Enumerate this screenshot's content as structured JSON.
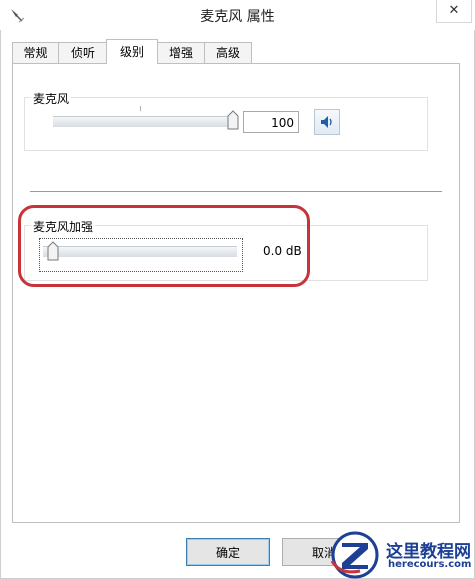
{
  "window": {
    "title": "麦克风 属性",
    "close_glyph": "✕"
  },
  "tabs": [
    {
      "label": "常规",
      "active": false
    },
    {
      "label": "侦听",
      "active": false
    },
    {
      "label": "级别",
      "active": true
    },
    {
      "label": "增强",
      "active": false
    },
    {
      "label": "高级",
      "active": false
    }
  ],
  "microphone": {
    "label": "麦克风",
    "level_value": "100",
    "level_fraction": 1.0,
    "speaker_icon": "speaker-icon"
  },
  "boost": {
    "label": "麦克风加强",
    "value_text": "0.0 dB",
    "level_fraction": 0.0
  },
  "buttons": {
    "ok": "确定",
    "cancel": "取消"
  },
  "watermark": {
    "main": "这里教程网",
    "sub": "herecours.com"
  },
  "colors": {
    "highlight": "#c8333a",
    "logo": "#1d3f94"
  }
}
